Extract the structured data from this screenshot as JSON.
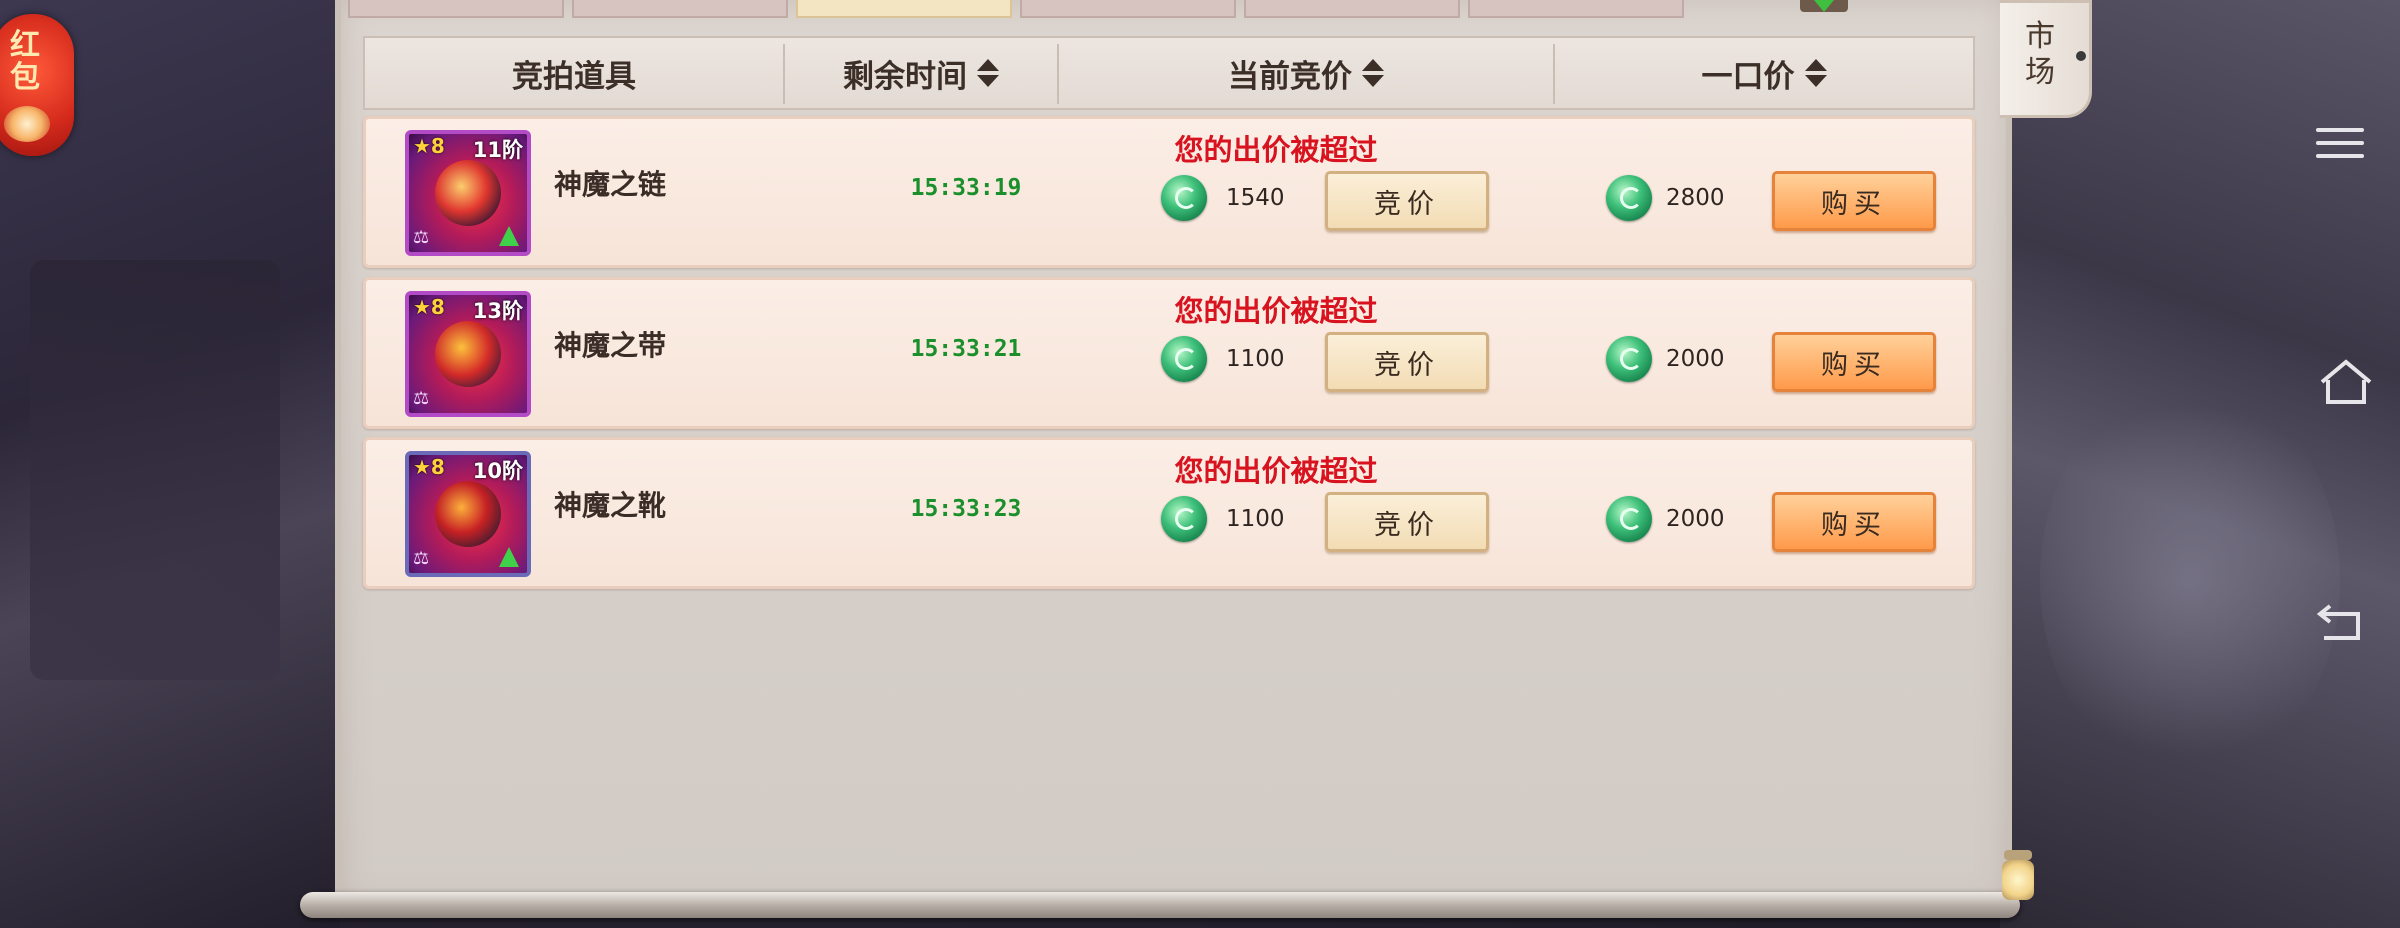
{
  "red_packet": {
    "label": "红包"
  },
  "market_tab": {
    "label": "市场"
  },
  "top_tabs": [
    {
      "active": false
    },
    {
      "active": false
    },
    {
      "active": true
    },
    {
      "active": false
    },
    {
      "active": false
    },
    {
      "active": false
    }
  ],
  "header": {
    "col_item": "竞拍道具",
    "col_time": "剩余时间",
    "col_price": "当前竞价",
    "col_buyout": "一口价"
  },
  "rows": [
    {
      "name": "神魔之链",
      "stars": "★8",
      "tier": "11阶",
      "status": "您的出价被超过",
      "time_left": "15:33:19",
      "current_bid": "1540",
      "bid_label": "竞价",
      "buyout": "2800",
      "buy_label": "购买"
    },
    {
      "name": "神魔之带",
      "stars": "★8",
      "tier": "13阶",
      "status": "您的出价被超过",
      "time_left": "15:33:21",
      "current_bid": "1100",
      "bid_label": "竞价",
      "buyout": "2000",
      "buy_label": "购买"
    },
    {
      "name": "神魔之靴",
      "stars": "★8",
      "tier": "10阶",
      "status": "您的出价被超过",
      "time_left": "15:33:23",
      "current_bid": "1100",
      "bid_label": "竞价",
      "buyout": "2000",
      "buy_label": "购买"
    }
  ],
  "colors": {
    "accent_red": "#d8121e",
    "time_green": "#1b8f2c",
    "buy_orange": "#ff9a4a"
  },
  "icons": [
    "jade-currency-icon",
    "sort-icon",
    "menu-icon",
    "home-icon",
    "back-icon",
    "lantern-icon"
  ]
}
